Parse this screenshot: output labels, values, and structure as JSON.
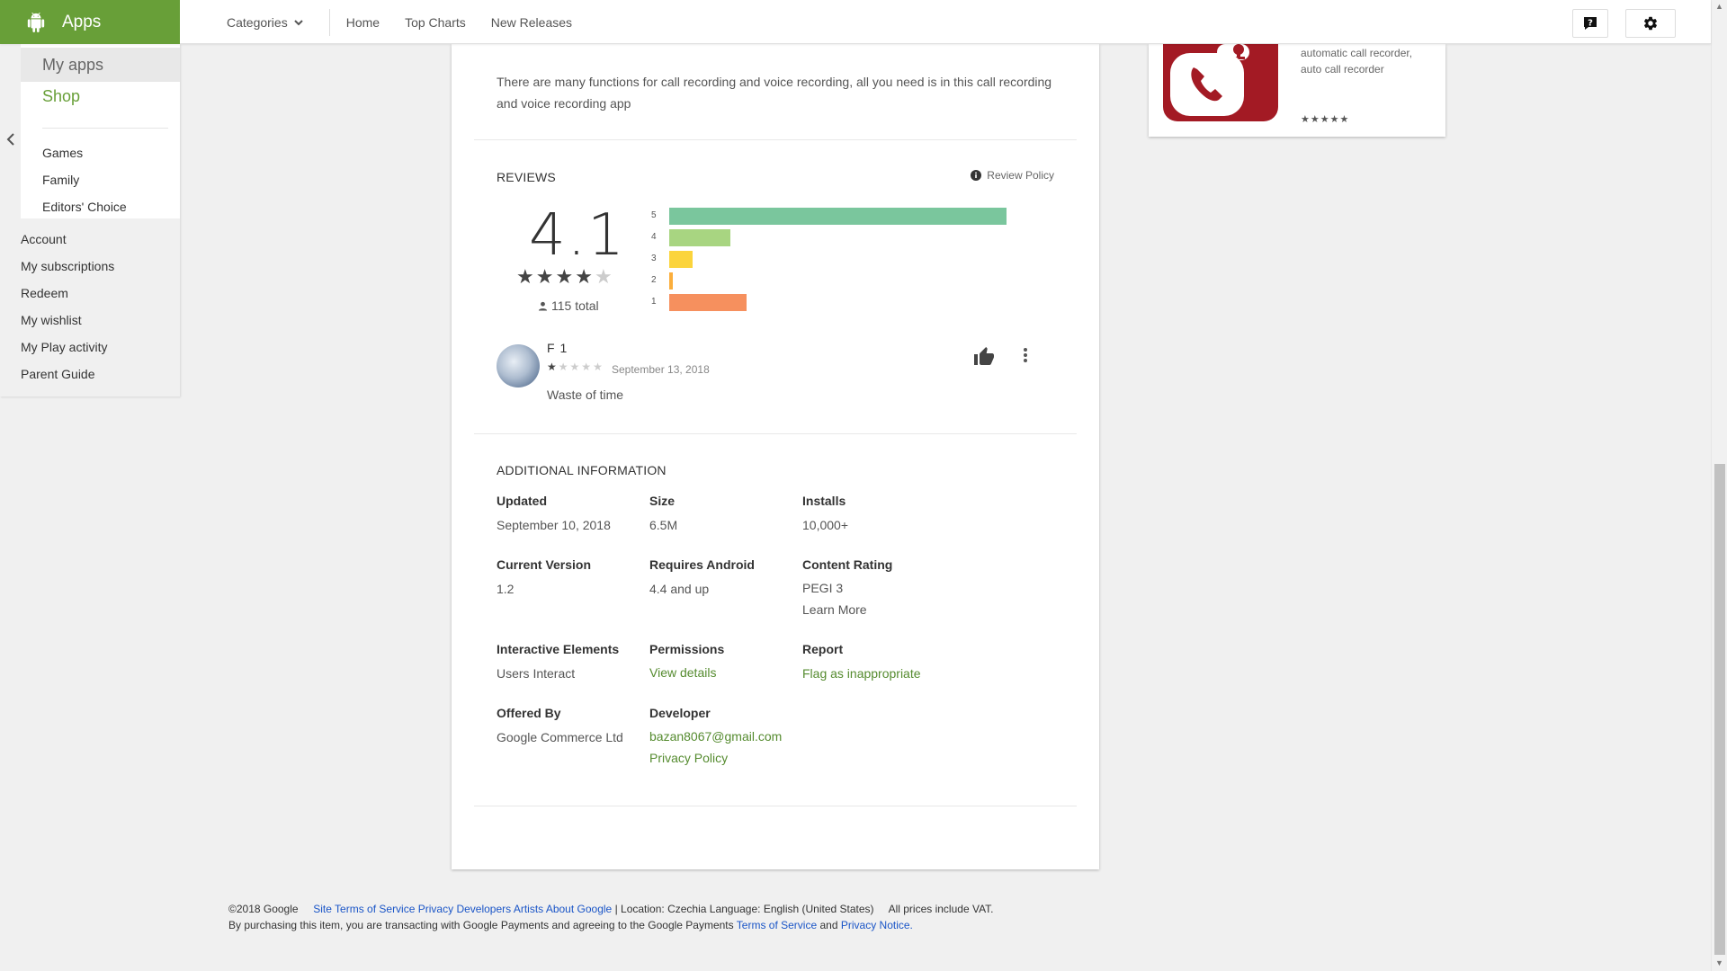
{
  "brand": {
    "label": "Apps"
  },
  "topnav": {
    "categories": "Categories",
    "home": "Home",
    "top_charts": "Top Charts",
    "new_releases": "New Releases"
  },
  "sidebar": {
    "my_apps": "My apps",
    "shop": "Shop",
    "links": [
      "Games",
      "Family",
      "Editors' Choice"
    ],
    "account_links": [
      "Account",
      "My subscriptions",
      "Redeem",
      "My wishlist",
      "My Play activity",
      "Parent Guide"
    ]
  },
  "description": "There are many functions for call recording and voice recording, all you need is in this call recording and voice recording app",
  "reviews": {
    "title": "REVIEWS",
    "policy": "Review Policy",
    "score": "4.1",
    "score_stars": 4,
    "total": "115 total",
    "histogram": [
      {
        "label": "5",
        "fraction": 1.0,
        "color": "#7ac69d"
      },
      {
        "label": "4",
        "fraction": 0.18,
        "color": "#a8d581"
      },
      {
        "label": "3",
        "fraction": 0.07,
        "color": "#fbd43c"
      },
      {
        "label": "2",
        "fraction": 0.01,
        "color": "#fbae3c"
      },
      {
        "label": "1",
        "fraction": 0.23,
        "color": "#f6905e"
      }
    ],
    "review": {
      "name": "F 1",
      "stars": 1,
      "date": "September 13, 2018",
      "text": "Waste of time"
    }
  },
  "additional": {
    "title": "ADDITIONAL INFORMATION",
    "updated_label": "Updated",
    "updated": "September 10, 2018",
    "size_label": "Size",
    "size": "6.5M",
    "installs_label": "Installs",
    "installs": "10,000+",
    "version_label": "Current Version",
    "version": "1.2",
    "android_label": "Requires Android",
    "android": "4.4 and up",
    "rating_label": "Content Rating",
    "rating": "PEGI 3",
    "rating_link": "Learn More",
    "interactive_label": "Interactive Elements",
    "interactive": "Users Interact",
    "permissions_label": "Permissions",
    "permissions": "View details",
    "report_label": "Report",
    "report": "Flag as inappropriate",
    "offered_label": "Offered By",
    "offered": "Google Commerce Ltd",
    "developer_label": "Developer",
    "developer_email": "bazan8067@gmail.com",
    "privacy": "Privacy Policy"
  },
  "similar": {
    "description": "automatic call recorder, auto call recorder",
    "stars": "★★★★★"
  },
  "footer": {
    "copyright": "©2018 Google",
    "links": [
      "Site Terms of Service",
      "Privacy",
      "Developers",
      "Artists",
      "About Google"
    ],
    "location": "Location: Czechia",
    "language": "Language: English (United States)",
    "vat": "All prices include VAT.",
    "line2_prefix": "By purchasing this item, you are transacting with Google Payments and agreeing to the Google Payments",
    "tos": "Terms of Service",
    "and": "and",
    "notice": "Privacy Notice."
  },
  "colors": {
    "brand": "#689f38",
    "star": "#333333",
    "link": "#1a55c7"
  }
}
